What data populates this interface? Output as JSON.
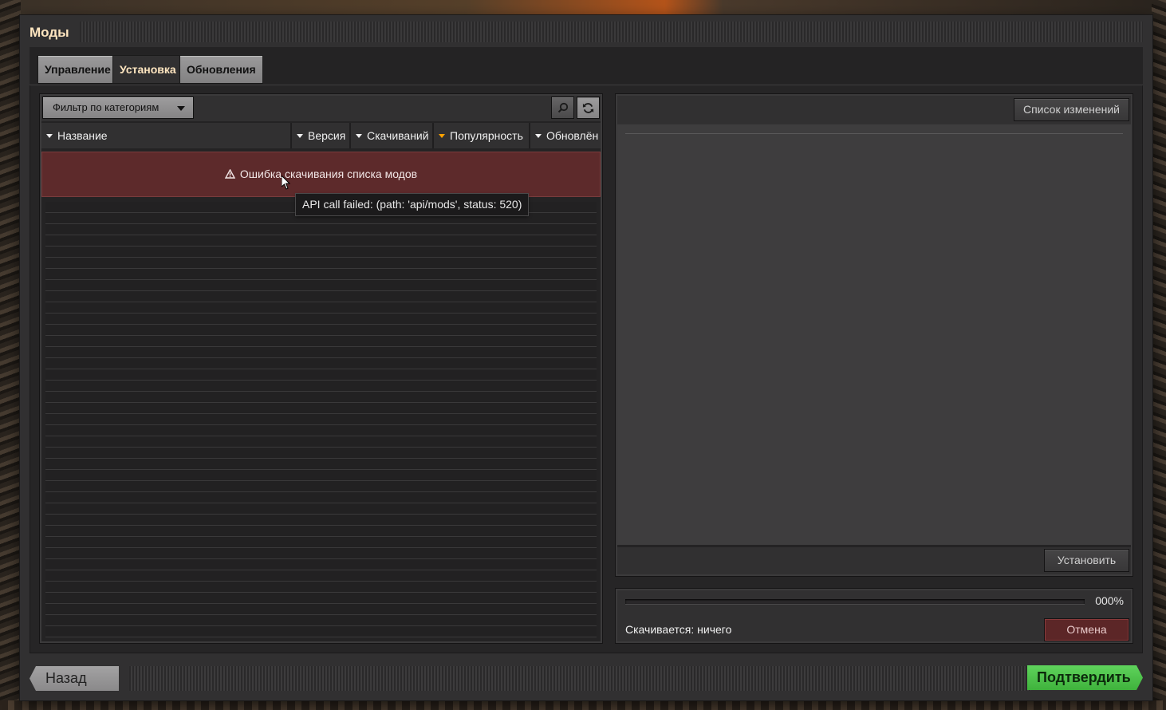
{
  "window": {
    "title": "Моды"
  },
  "tabs": [
    {
      "label": "Управление"
    },
    {
      "label": "Установка"
    },
    {
      "label": "Обновления"
    }
  ],
  "filter": {
    "label": "Фильтр по категориям"
  },
  "icons": {
    "search": "search-icon",
    "refresh": "refresh-icon",
    "warning": "warning-icon",
    "filter_caret": "chevron-down-icon"
  },
  "columns": [
    {
      "label": "Название"
    },
    {
      "label": "Версия"
    },
    {
      "label": "Скачиваний"
    },
    {
      "label": "Популярность",
      "sorted": true
    },
    {
      "label": "Обновлён"
    }
  ],
  "error": {
    "message": "Ошибка скачивания списка модов"
  },
  "tooltip": {
    "text": "API call failed: (path: 'api/mods', status: 520)"
  },
  "details": {
    "changelog_button": "Список изменений",
    "install_button": "Установить"
  },
  "download": {
    "progress_percent": "000%",
    "progress_value": 0,
    "status": "Скачивается: ничего",
    "cancel_button": "Отмена"
  },
  "footer": {
    "back_button": "Назад",
    "confirm_button": "Подтвердить"
  },
  "colors": {
    "accent": "#ffa200",
    "error_bg": "#5d2a2b",
    "confirm": "#4fc24c",
    "title": "#ffe6c0"
  }
}
